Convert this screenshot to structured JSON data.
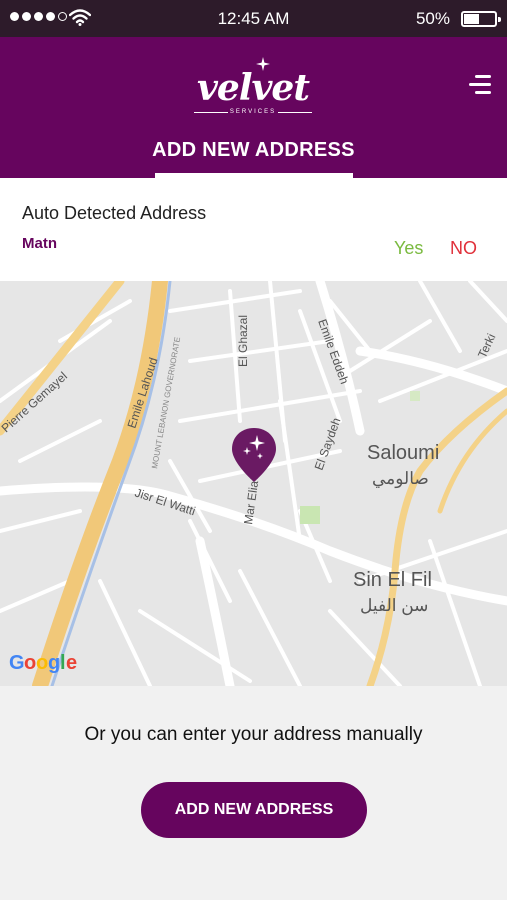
{
  "status_bar": {
    "time": "12:45 AM",
    "battery_pct": "50%",
    "battery_level": 0.5,
    "signal_bars_filled": 4,
    "signal_bars_total": 5,
    "icons": [
      "signal-dots-icon",
      "wifi-icon",
      "battery-icon"
    ]
  },
  "header": {
    "logo_text": "velvet",
    "logo_subtext": "SERVICES",
    "title": "ADD NEW ADDRESS",
    "menu_icon": "menu-icon",
    "background": "#66055e"
  },
  "detected": {
    "title": "Auto Detected Address",
    "area": "Matn",
    "yes_label": "Yes",
    "no_label": "NO",
    "yes_color": "#7aba3f",
    "no_color": "#e0303a"
  },
  "map": {
    "labels": {
      "pierre_gemayel": "Pierre Gemayel",
      "emile_lahoud": "Emile Lahoud",
      "governorate": "MOUNT LEBANON GOVERNORATE",
      "el_ghazal": "El Ghazal",
      "emile_eddeh": "Emile Eddeh",
      "terki": "Terki",
      "el_saydeh": "El Saydeh",
      "saloumi": "Saloumi",
      "saloumi_ar": "صالومي",
      "jisr_el_watti": "Jisr El Watti",
      "mar_elia": "Mar Elia",
      "sin_el_fil": "Sin El Fil",
      "sin_el_fil_ar": "سن الفيل"
    },
    "attribution": "Google",
    "pin_icon": "location-pin-icon"
  },
  "bottom": {
    "hint": "Or you can enter your address manually",
    "button_label": "ADD NEW ADDRESS"
  }
}
